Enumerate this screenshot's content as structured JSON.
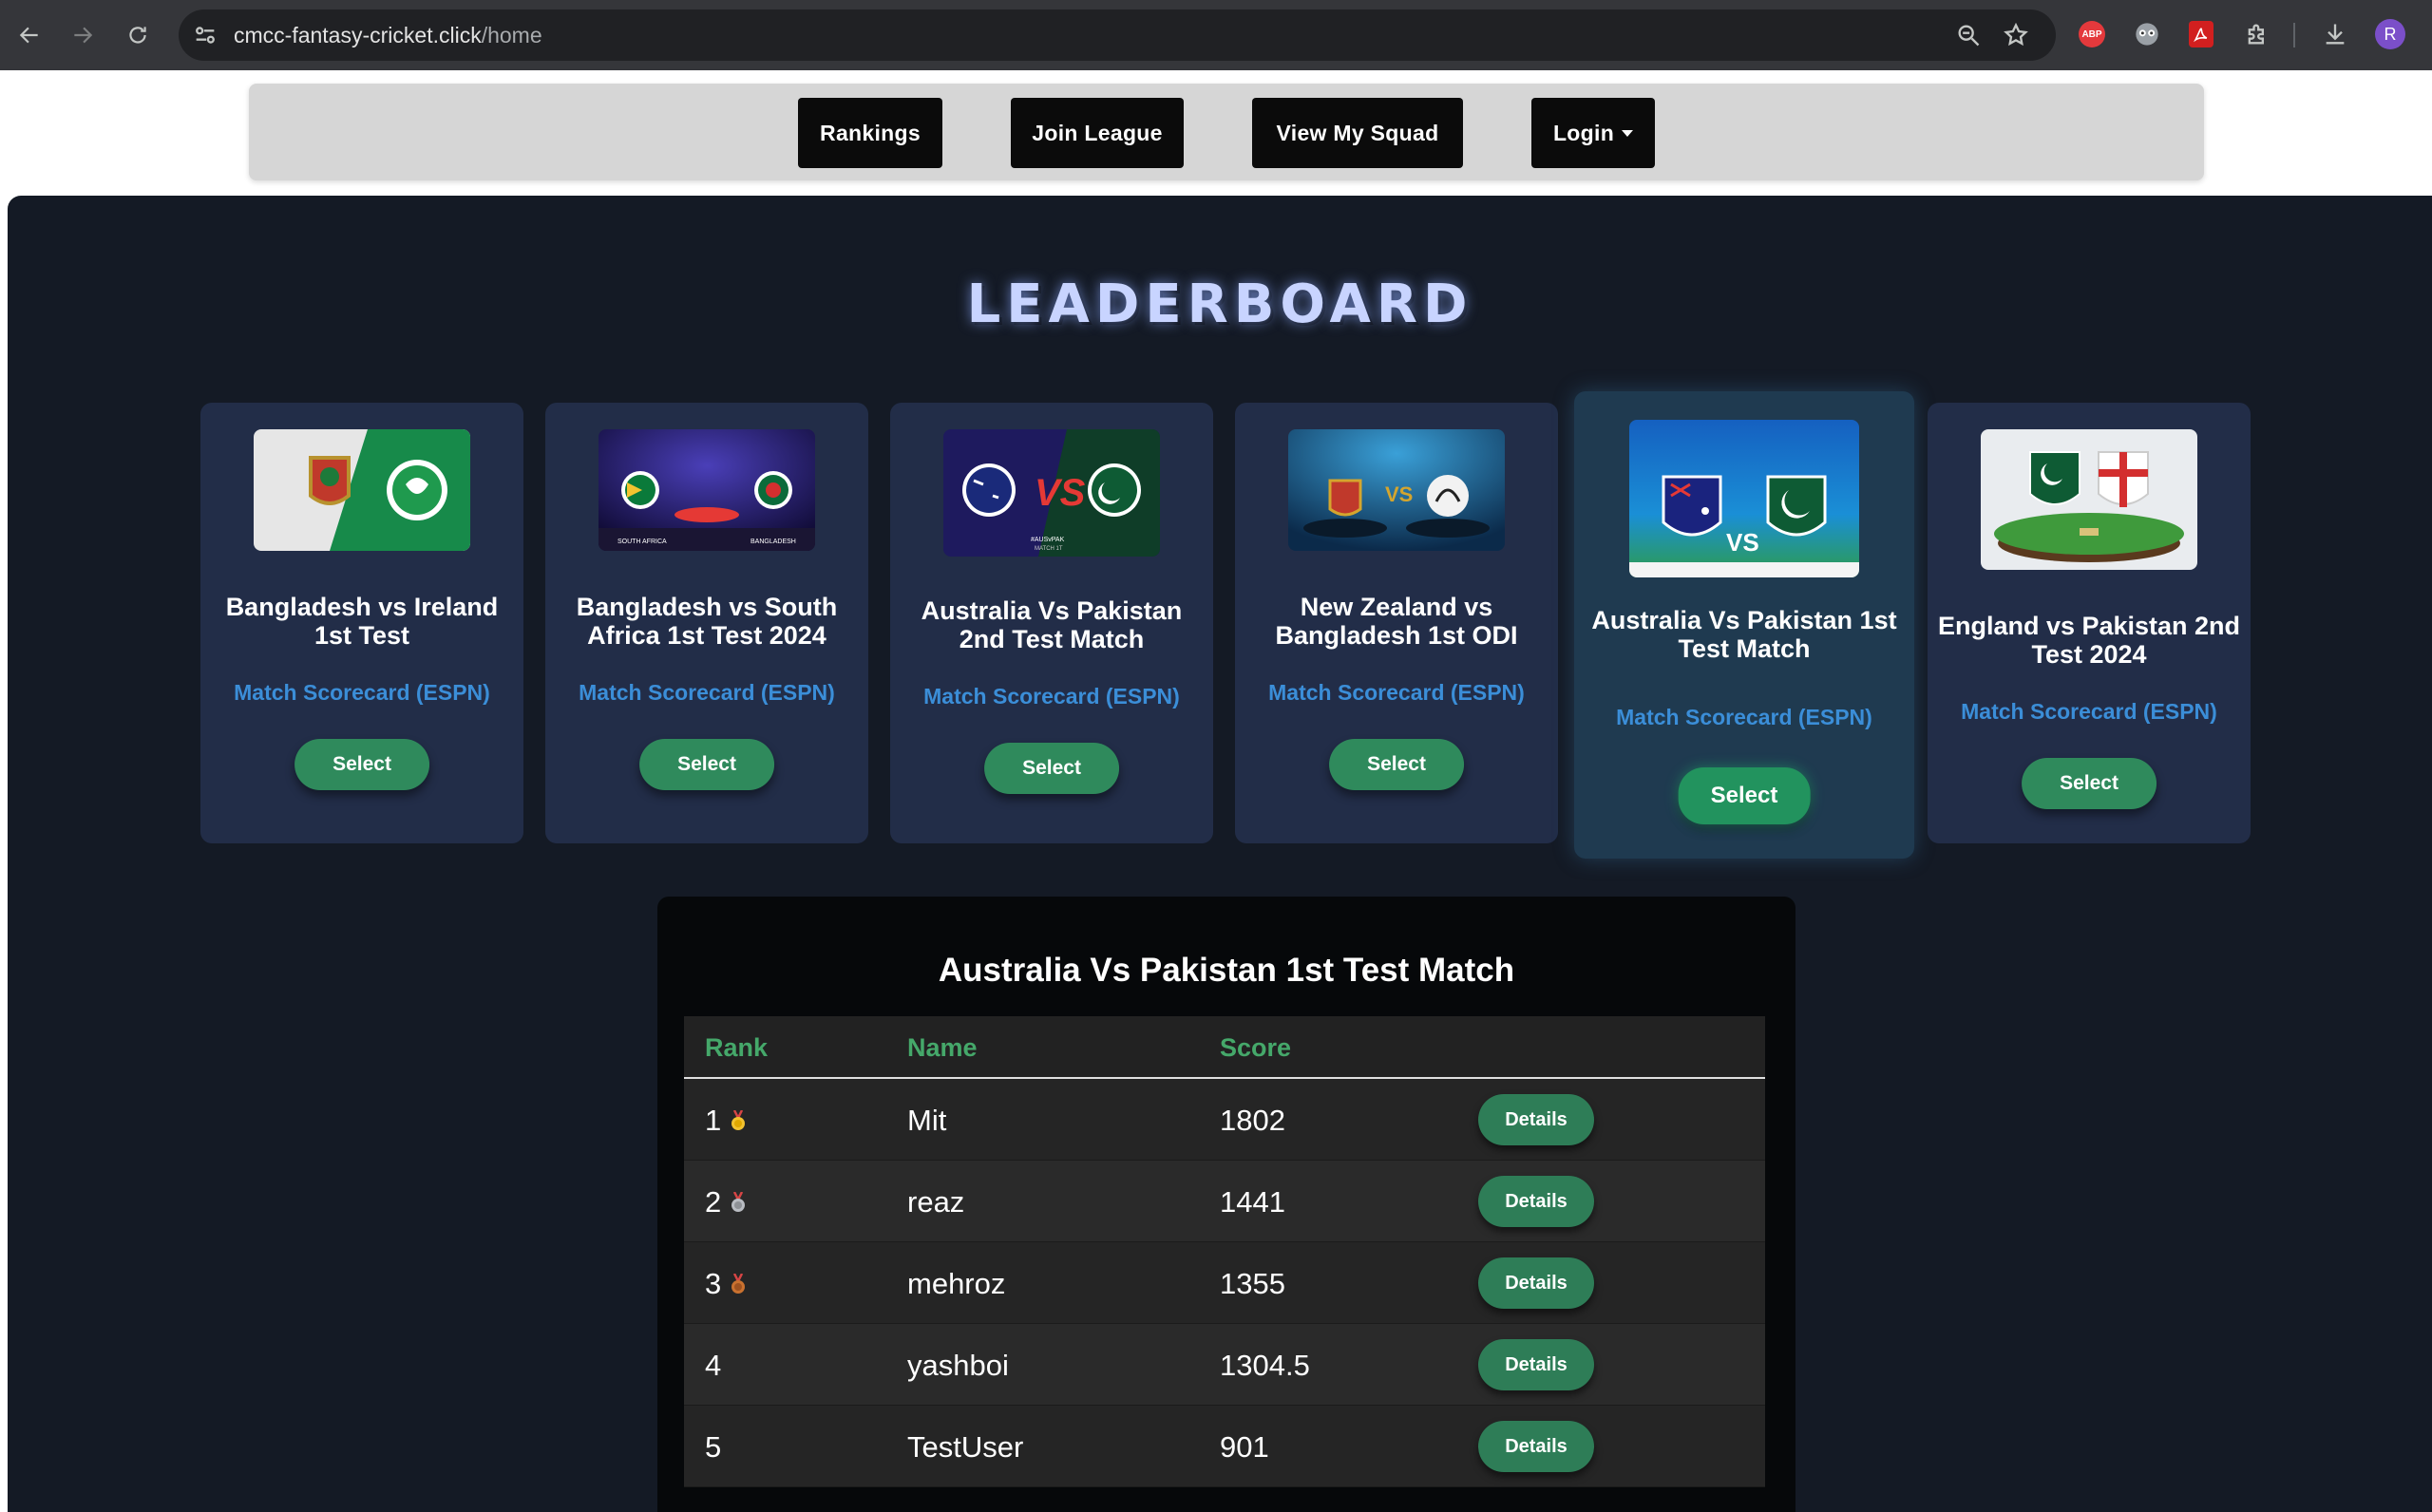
{
  "browser": {
    "url_host": "cmcc-fantasy-cricket.click",
    "url_path": "/home",
    "avatar_initial": "R",
    "abp_label": "ABP"
  },
  "nav": {
    "rankings": "Rankings",
    "join_league": "Join League",
    "view_squad": "View My Squad",
    "login": "Login"
  },
  "leaderboard": {
    "title": "LEADERBOARD"
  },
  "matches": [
    {
      "title": "Bangladesh vs Ireland 1st Test",
      "link": "Match Scorecard (ESPN)",
      "button": "Select"
    },
    {
      "title": "Bangladesh vs South Africa 1st Test 2024",
      "link": "Match Scorecard (ESPN)",
      "button": "Select"
    },
    {
      "title": "Australia Vs Pakistan 2nd Test Match",
      "link": "Match Scorecard (ESPN)",
      "button": "Select"
    },
    {
      "title": "New Zealand vs Bangladesh 1st ODI",
      "link": "Match Scorecard (ESPN)",
      "button": "Select"
    },
    {
      "title": "Australia Vs Pakistan 1st Test Match",
      "link": "Match Scorecard (ESPN)",
      "button": "Select",
      "selected": true
    },
    {
      "title": "England vs Pakistan 2nd Test 2024",
      "link": "Match Scorecard (ESPN)",
      "button": "Select"
    }
  ],
  "thumb_labels": {
    "sa": "SOUTH AFRICA",
    "bd": "BANGLADESH",
    "vs": "VS",
    "hashtag": "#AUSvPAK",
    "match": "MATCH 1T"
  },
  "table": {
    "title": "Australia Vs Pakistan 1st Test Match",
    "headers": {
      "rank": "Rank",
      "name": "Name",
      "score": "Score"
    },
    "rows": [
      {
        "rank": "1",
        "name": "Mit",
        "score": "1802",
        "action": "Details",
        "medal": "gold"
      },
      {
        "rank": "2",
        "name": "reaz",
        "score": "1441",
        "action": "Details",
        "medal": "silver"
      },
      {
        "rank": "3",
        "name": "mehroz",
        "score": "1355",
        "action": "Details",
        "medal": "bronze"
      },
      {
        "rank": "4",
        "name": "yashboi",
        "score": "1304.5",
        "action": "Details"
      },
      {
        "rank": "5",
        "name": "TestUser",
        "score": "901",
        "action": "Details"
      }
    ]
  },
  "colors": {
    "panel": "#141a25",
    "card": "#222d48",
    "accent_green": "#2f8a5c",
    "link_blue": "#3b8ed8",
    "gold": "#f2c230",
    "silver": "#b9bcc2",
    "bronze": "#c9712f"
  }
}
